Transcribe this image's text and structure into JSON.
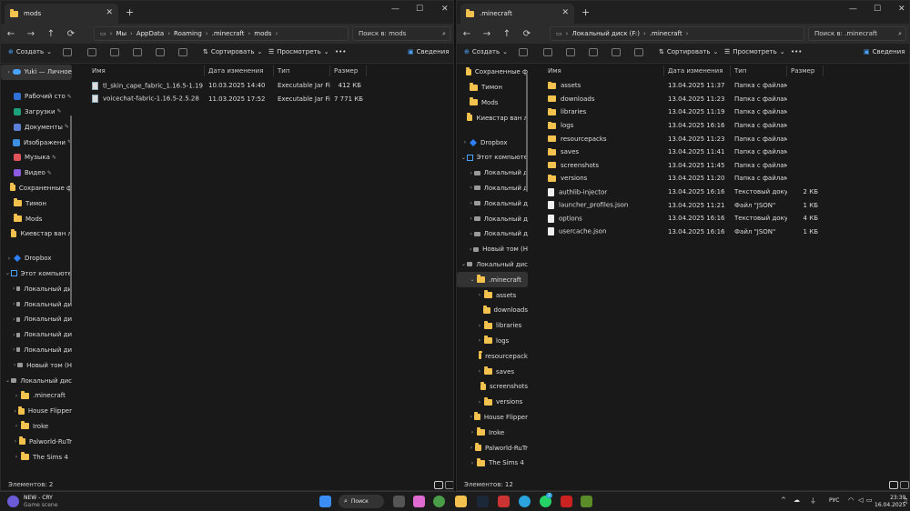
{
  "left": {
    "tab_title": "mods",
    "breadcrumbs": [
      "Мы",
      "AppData",
      "Roaming",
      ".minecraft",
      "mods"
    ],
    "search_placeholder": "Поиск в: mods",
    "toolbar": {
      "create": "Создать",
      "sort": "Сортировать",
      "view": "Просмотреть",
      "more": "•••",
      "details": "Сведения"
    },
    "sidebar": [
      {
        "label": "Yuki — Личное",
        "icon": "cloud",
        "chev": "›",
        "sel": true
      },
      {
        "gap": true
      },
      {
        "label": "Рабочий сто",
        "icon": "desktop",
        "pin": true
      },
      {
        "label": "Загрузки",
        "icon": "download",
        "pin": true
      },
      {
        "label": "Документы",
        "icon": "documents",
        "pin": true
      },
      {
        "label": "Изображени",
        "icon": "pictures",
        "pin": true
      },
      {
        "label": "Музыка",
        "icon": "music",
        "pin": true
      },
      {
        "label": "Видео",
        "icon": "video",
        "pin": true
      },
      {
        "label": "Сохраненные ф",
        "icon": "folder"
      },
      {
        "label": "Тимон",
        "icon": "folder"
      },
      {
        "label": "Mods",
        "icon": "folder"
      },
      {
        "label": "Киевстар ван л",
        "icon": "folder"
      },
      {
        "gap": true
      },
      {
        "label": "Dropbox",
        "icon": "dropbox",
        "chev": "›"
      },
      {
        "label": "Этот компьюте",
        "icon": "pc",
        "chev": "⌄"
      },
      {
        "label": "Локальный ди",
        "icon": "drive",
        "chev": "›",
        "indent": 1
      },
      {
        "label": "Локальный ди",
        "icon": "drive",
        "chev": "›",
        "indent": 1
      },
      {
        "label": "Локальный ди",
        "icon": "drive",
        "chev": "›",
        "indent": 1
      },
      {
        "label": "Локальный ди",
        "icon": "drive",
        "chev": "›",
        "indent": 1
      },
      {
        "label": "Локальный ди",
        "icon": "drive",
        "chev": "›",
        "indent": 1
      },
      {
        "label": "Новый том (H",
        "icon": "drive",
        "chev": "›",
        "indent": 1
      },
      {
        "label": "Локальный дис",
        "icon": "drive",
        "chev": "⌄"
      },
      {
        "label": ".minecraft",
        "icon": "folder",
        "chev": "›",
        "indent": 1
      },
      {
        "label": "House Flipper",
        "icon": "folder",
        "chev": "›",
        "indent": 1
      },
      {
        "label": "Iroke",
        "icon": "folder",
        "chev": "›",
        "indent": 1
      },
      {
        "label": "Palworld-RuTr",
        "icon": "folder",
        "chev": "›",
        "indent": 1
      },
      {
        "label": "The Sims 4",
        "icon": "folder",
        "chev": "›",
        "indent": 1
      }
    ],
    "columns": [
      "Имя",
      "Дата изменения",
      "Тип",
      "Размер"
    ],
    "files": [
      {
        "name": "tl_skin_cape_fabric_1.16.5-1.19",
        "date": "10.03.2025 14:40",
        "type": "Executable Jar File",
        "size": "412 КБ",
        "icon": "jar"
      },
      {
        "name": "voicechat-fabric-1.16.5-2.5.28",
        "date": "11.03.2025 17:52",
        "type": "Executable Jar File",
        "size": "7 771 КБ",
        "icon": "jar"
      }
    ],
    "status": "Элементов: 2"
  },
  "right": {
    "tab_title": ".minecraft",
    "breadcrumbs": [
      "Локальный диск (F:)",
      ".minecraft"
    ],
    "search_placeholder": "Поиск в: .minecraft",
    "toolbar": {
      "create": "Создать",
      "sort": "Сортировать",
      "view": "Просмотреть",
      "more": "•••",
      "details": "Сведения"
    },
    "sidebar": [
      {
        "label": "Сохраненные ф",
        "icon": "folder"
      },
      {
        "label": "Тимон",
        "icon": "folder"
      },
      {
        "label": "Mods",
        "icon": "folder"
      },
      {
        "label": "Киевстар ван л",
        "icon": "folder"
      },
      {
        "gap": true
      },
      {
        "label": "Dropbox",
        "icon": "dropbox",
        "chev": "›"
      },
      {
        "label": "Этот компьюте",
        "icon": "pc",
        "chev": "⌄"
      },
      {
        "label": "Локальный д",
        "icon": "drive",
        "chev": "›",
        "indent": 1
      },
      {
        "label": "Локальный д",
        "icon": "drive",
        "chev": "›",
        "indent": 1
      },
      {
        "label": "Локальный д",
        "icon": "drive",
        "chev": "›",
        "indent": 1
      },
      {
        "label": "Локальный д",
        "icon": "drive",
        "chev": "›",
        "indent": 1
      },
      {
        "label": "Локальный д",
        "icon": "drive",
        "chev": "›",
        "indent": 1
      },
      {
        "label": "Новый том (H",
        "icon": "drive",
        "chev": "›",
        "indent": 1
      },
      {
        "label": "Локальный дис",
        "icon": "drive",
        "chev": "⌄"
      },
      {
        "label": ".minecraft",
        "icon": "folder",
        "chev": "⌄",
        "indent": 1,
        "sel": true
      },
      {
        "label": "assets",
        "icon": "folder",
        "chev": "›",
        "indent": 2
      },
      {
        "label": "downloads",
        "icon": "folder",
        "indent": 2
      },
      {
        "label": "libraries",
        "icon": "folder",
        "chev": "›",
        "indent": 2
      },
      {
        "label": "logs",
        "icon": "folder",
        "chev": "›",
        "indent": 2
      },
      {
        "label": "resourcepack",
        "icon": "folder",
        "indent": 2
      },
      {
        "label": "saves",
        "icon": "folder",
        "chev": "›",
        "indent": 2
      },
      {
        "label": "screenshots",
        "icon": "folder",
        "indent": 2
      },
      {
        "label": "versions",
        "icon": "folder",
        "chev": "›",
        "indent": 2
      },
      {
        "label": "House Flipper",
        "icon": "folder",
        "chev": "›",
        "indent": 1
      },
      {
        "label": "Iroke",
        "icon": "folder",
        "chev": "›",
        "indent": 1
      },
      {
        "label": "Palworld-RuTr",
        "icon": "folder",
        "chev": "›",
        "indent": 1
      },
      {
        "label": "The Sims 4",
        "icon": "folder",
        "chev": "›",
        "indent": 1
      }
    ],
    "columns": [
      "Имя",
      "Дата изменения",
      "Тип",
      "Размер"
    ],
    "files": [
      {
        "name": "assets",
        "date": "13.04.2025 11:37",
        "type": "Папка с файлами",
        "size": "",
        "icon": "folder"
      },
      {
        "name": "downloads",
        "date": "13.04.2025 11:23",
        "type": "Папка с файлами",
        "size": "",
        "icon": "folder"
      },
      {
        "name": "libraries",
        "date": "13.04.2025 11:19",
        "type": "Папка с файлами",
        "size": "",
        "icon": "folder"
      },
      {
        "name": "logs",
        "date": "13.04.2025 16:16",
        "type": "Папка с файлами",
        "size": "",
        "icon": "folder"
      },
      {
        "name": "resourcepacks",
        "date": "13.04.2025 11:23",
        "type": "Папка с файлами",
        "size": "",
        "icon": "folder"
      },
      {
        "name": "saves",
        "date": "13.04.2025 11:41",
        "type": "Папка с файлами",
        "size": "",
        "icon": "folder"
      },
      {
        "name": "screenshots",
        "date": "13.04.2025 11:45",
        "type": "Папка с файлами",
        "size": "",
        "icon": "folder"
      },
      {
        "name": "versions",
        "date": "13.04.2025 11:20",
        "type": "Папка с файлами",
        "size": "",
        "icon": "folder"
      },
      {
        "name": "authlib-injector",
        "date": "13.04.2025 16:16",
        "type": "Текстовый докум...",
        "size": "2 КБ",
        "icon": "file"
      },
      {
        "name": "launcher_profiles.json",
        "date": "13.04.2025 11:21",
        "type": "Файл \"JSON\"",
        "size": "1 КБ",
        "icon": "file"
      },
      {
        "name": "options",
        "date": "13.04.2025 16:16",
        "type": "Текстовый докум...",
        "size": "4 КБ",
        "icon": "file"
      },
      {
        "name": "usercache.json",
        "date": "13.04.2025 16:16",
        "type": "Файл \"JSON\"",
        "size": "1 КБ",
        "icon": "file"
      }
    ],
    "status": "Элементов: 12"
  },
  "taskbar": {
    "widget_title": "NEW - CRY",
    "widget_sub": "Game scene",
    "search": "Поиск",
    "lang": "РУС",
    "time": "23:39",
    "date": "16.04.2025",
    "badge": "2"
  },
  "colors": {
    "folder": "#f2c14e",
    "accent": "#4aa3ff",
    "window_bg": "#191919"
  }
}
